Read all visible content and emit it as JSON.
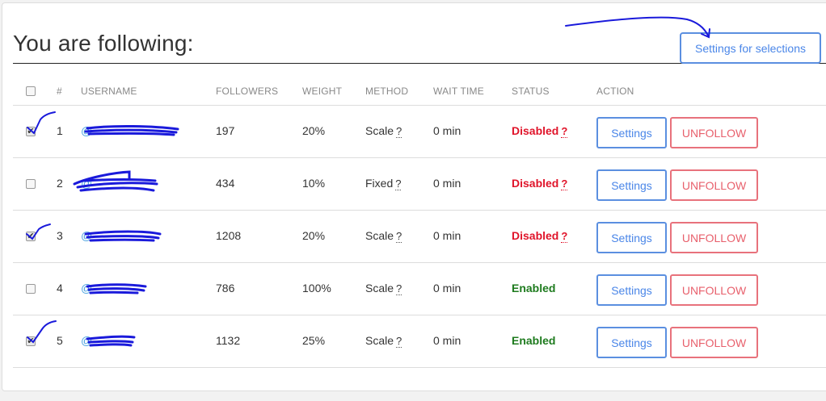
{
  "title": "You are following:",
  "selections_button": "Settings for selections",
  "columns": {
    "num": "#",
    "username": "USERNAME",
    "followers": "FOLLOWERS",
    "weight": "WEIGHT",
    "method": "METHOD",
    "wait_time": "WAIT TIME",
    "status": "STATUS",
    "action": "ACTION"
  },
  "rows": [
    {
      "checked": true,
      "num": "1",
      "username": "@",
      "followers": "197",
      "weight": "20%",
      "method": "Scale",
      "wait": "0 min",
      "status": "Disabled",
      "status_q": "?",
      "method_q": "?",
      "settings": "Settings",
      "unfollow": "UNFOLLOW"
    },
    {
      "checked": false,
      "num": "2",
      "username": "@",
      "followers": "434",
      "weight": "10%",
      "method": "Fixed",
      "wait": "0 min",
      "status": "Disabled",
      "status_q": "?",
      "method_q": "?",
      "settings": "Settings",
      "unfollow": "UNFOLLOW"
    },
    {
      "checked": true,
      "num": "3",
      "username": "@",
      "followers": "1208",
      "weight": "20%",
      "method": "Scale",
      "wait": "0 min",
      "status": "Disabled",
      "status_q": "?",
      "method_q": "?",
      "settings": "Settings",
      "unfollow": "UNFOLLOW"
    },
    {
      "checked": false,
      "num": "4",
      "username": "@",
      "followers": "786",
      "weight": "100%",
      "method": "Scale",
      "wait": "0 min",
      "status": "Enabled",
      "status_q": "",
      "method_q": "?",
      "settings": "Settings",
      "unfollow": "UNFOLLOW"
    },
    {
      "checked": true,
      "num": "5",
      "username": "@",
      "followers": "1132",
      "weight": "25%",
      "method": "Scale",
      "wait": "0 min",
      "status": "Enabled",
      "status_q": "",
      "method_q": "?",
      "settings": "Settings",
      "unfollow": "UNFOLLOW"
    }
  ],
  "colors": {
    "accent_blue": "#4a86e8",
    "danger_red": "#e8606c",
    "disabled_red": "#e0142a",
    "enabled_green": "#1e7b1e",
    "annotation_ink": "#1a1adb"
  }
}
